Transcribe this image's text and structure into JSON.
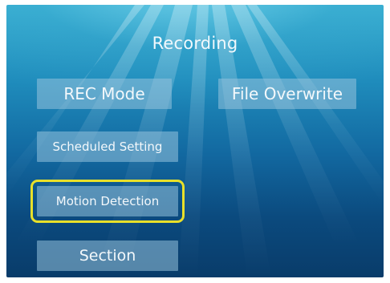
{
  "screen": {
    "title": "Recording"
  },
  "menu": {
    "rec_mode": "REC Mode",
    "file_overwrite": "File Overwrite",
    "scheduled_setting": "Scheduled Setting",
    "motion_detection": "Motion Detection",
    "section": "Section",
    "selected_item": "Motion Detection"
  },
  "colors": {
    "background_top": "#3ab0d2",
    "background_bottom": "#093c6a",
    "button_fill": "#96c3dc",
    "focus_highlight": "#e8e02a",
    "text": "#f3f8fb"
  }
}
